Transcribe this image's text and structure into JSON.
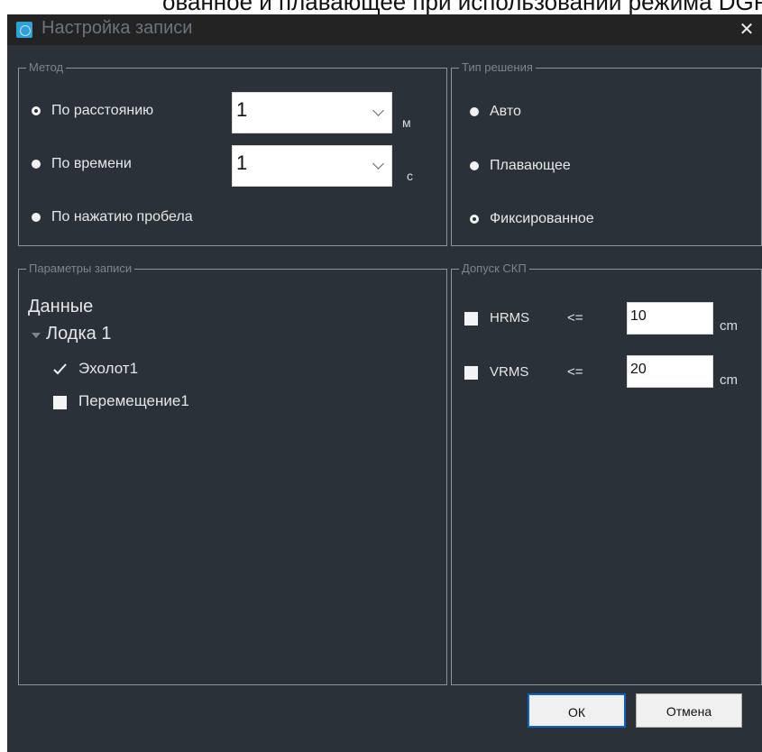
{
  "caption": "ованное и плавающее при использовании режима DGP",
  "window": {
    "title": "Настройка записи",
    "close_glyph": "✕"
  },
  "method": {
    "title": "Метод",
    "options": [
      {
        "label": "По расстоянию",
        "selected": true,
        "value": "1",
        "unit": "м"
      },
      {
        "label": "По времени",
        "selected": false,
        "value": "1",
        "unit": "с"
      },
      {
        "label": "По нажатию пробела",
        "selected": false
      }
    ]
  },
  "solution": {
    "title": "Тип решения",
    "options": [
      {
        "label": "Авто",
        "selected": false
      },
      {
        "label": "Плавающее",
        "selected": false
      },
      {
        "label": "Фиксированное",
        "selected": true
      }
    ]
  },
  "record": {
    "title": "Параметры записи",
    "root": "Данные",
    "node": "Лодка 1",
    "items": [
      {
        "label": "Эхолот1",
        "checked": true
      },
      {
        "label": "Перемещение1",
        "checked": false
      }
    ]
  },
  "tolerance": {
    "title": "Допуск СКП",
    "rows": [
      {
        "label": "HRMS",
        "op": "<=",
        "value": "10",
        "unit": "cm",
        "checked": false
      },
      {
        "label": "VRMS",
        "op": "<=",
        "value": "20",
        "unit": "cm",
        "checked": false
      }
    ]
  },
  "buttons": {
    "ok": "ОК",
    "cancel": "Отмена"
  },
  "colors": {
    "dialog_bg": "#2b3138",
    "titlebar_bg": "#232323",
    "ok_border": "#0a63c9",
    "icon": "#2f9fd8"
  }
}
